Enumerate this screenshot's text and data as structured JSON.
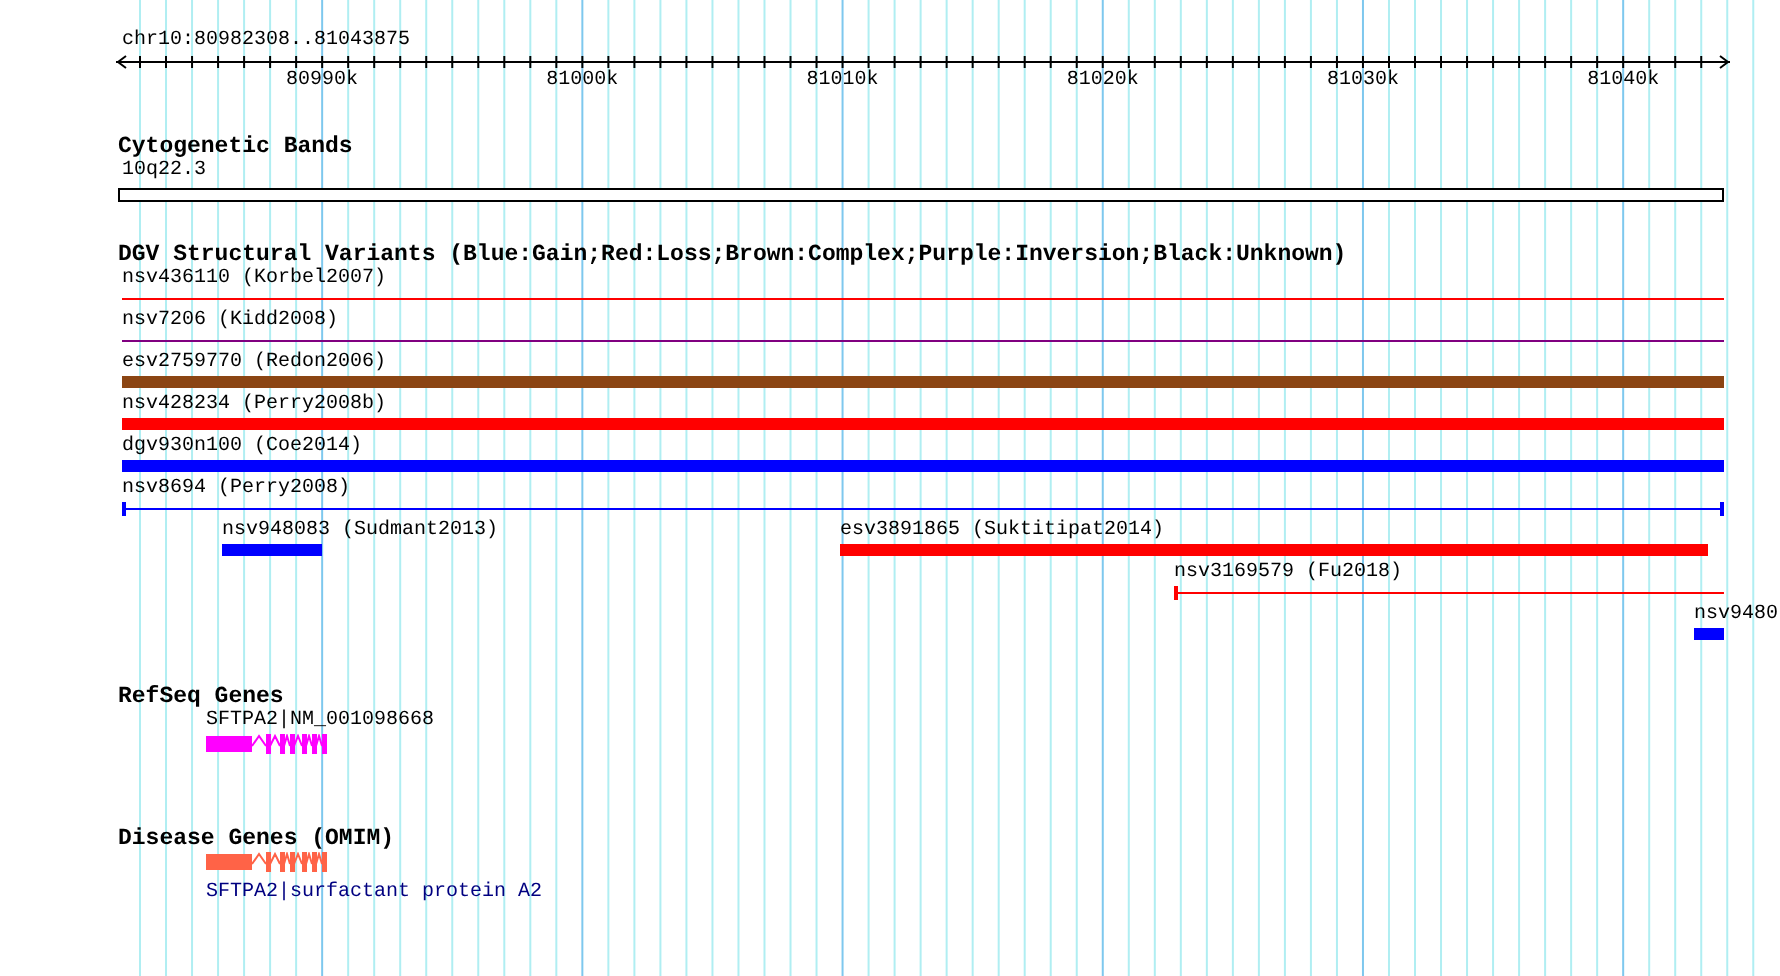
{
  "ruler": {
    "location": "chr10:80982308..81043875",
    "ticks": [
      "80990k",
      "81000k",
      "81010k",
      "81020k",
      "81030k",
      "81040k"
    ]
  },
  "tracks": [
    {
      "kind": "bands",
      "title": "Cytogenetic Bands",
      "features": [
        {
          "label": "10q22.3"
        }
      ]
    },
    {
      "kind": "variants",
      "title": "DGV Structural Variants (Blue:Gain;Red:Loss;Brown:Complex;Purple:Inversion;Black:Unknown)",
      "rows": [
        [
          {
            "label": "nsv436110 (Korbel2007)",
            "kind": "line",
            "color": "#ff0000"
          }
        ],
        [
          {
            "label": "nsv7206 (Kidd2008)",
            "kind": "line",
            "color": "#800080"
          }
        ],
        [
          {
            "label": "esv2759770 (Redon2006)",
            "kind": "bar",
            "color": "#8b4513"
          }
        ],
        [
          {
            "label": "nsv428234 (Perry2008b)",
            "kind": "bar",
            "color": "#ff0000"
          }
        ],
        [
          {
            "label": "dgv930n100 (Coe2014)",
            "kind": "bar",
            "color": "#0000ff"
          }
        ],
        [
          {
            "label": "nsv8694 (Perry2008)",
            "kind": "line",
            "color": "#0000ff"
          }
        ],
        [
          {
            "label": "nsv948083 (Sudmant2013)",
            "kind": "bar",
            "color": "#0000ff"
          },
          {
            "label": "esv3891865 (Suktitipat2014)",
            "kind": "bar",
            "color": "#ff0000"
          }
        ],
        [
          {
            "label": "nsv3169579 (Fu2018)",
            "kind": "line",
            "color": "#ff0000"
          }
        ],
        [
          {
            "label": "nsv9480",
            "kind": "bar",
            "color": "#0000ff"
          }
        ]
      ]
    },
    {
      "kind": "genes",
      "title": "RefSeq Genes",
      "features": [
        {
          "label": "SFTPA2|NM_001098668",
          "kind": "transcript",
          "link": false,
          "color": "#ff00ff"
        }
      ]
    },
    {
      "kind": "genes",
      "title": "Disease Genes (OMIM)",
      "features": [
        {
          "label": "SFTPA2|surfactant protein A2",
          "kind": "disease",
          "link": true,
          "color": "#ff6347"
        }
      ]
    }
  ]
}
